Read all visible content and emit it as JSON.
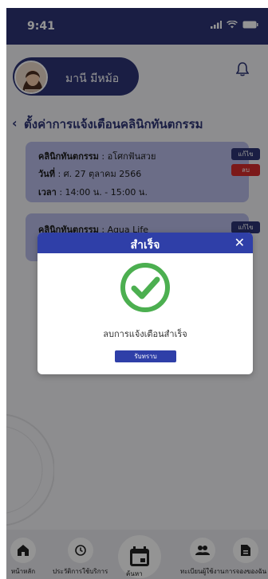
{
  "status": {
    "time": "9:41"
  },
  "profile": {
    "name": "มานี มีหม้อ"
  },
  "page": {
    "title": "ตั้งค่าการแจ้งเตือนคลินิกทันตกรรม"
  },
  "reminders": [
    {
      "clinic_label": "คลินิกทันตกรรม",
      "clinic_value": " : อโศกฟันสวย",
      "date_label": "วันที่",
      "date_value": " : ศ. 27 ตุลาคม 2566",
      "time_label": "เวลา",
      "time_value": " : 14:00 น. - 15:00 น.",
      "edit_label": "แก้ไข",
      "delete_label": "ลบ"
    },
    {
      "clinic_label": "คลินิกทันตกรรม",
      "clinic_value": " : Aqua Life",
      "edit_label": "แก้ไข"
    }
  ],
  "modal": {
    "title": "สำเร็จ",
    "close": "✕",
    "message": "ลบการแจ้งเตือนสำเร็จ",
    "confirm_label": "รับทราบ"
  },
  "nav": {
    "home": "หน้าหลัก",
    "history": "ประวัติการใช้บริการ",
    "search": "ค้นหา",
    "registry": "ทะเบียนผู้ใช้งาน",
    "booking": "การจองของฉัน"
  },
  "colors": {
    "primary": "#2e3575",
    "modal_header": "#2f3fa8",
    "card": "#b8bce8",
    "delete": "#d62b2b",
    "success": "#4caf50"
  }
}
